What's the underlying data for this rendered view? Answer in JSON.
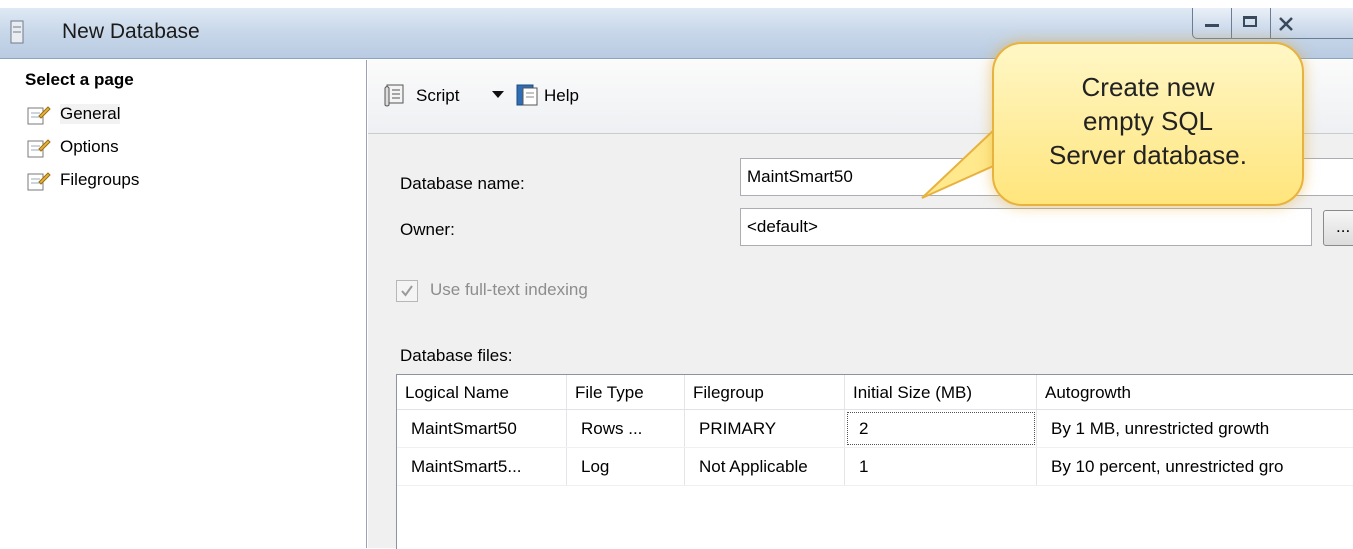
{
  "window": {
    "title": "New Database"
  },
  "left_pane": {
    "heading": "Select a page",
    "pages": [
      {
        "label": "General",
        "selected": true,
        "icon": "page-wrench-icon"
      },
      {
        "label": "Options",
        "selected": false,
        "icon": "page-wrench-icon"
      },
      {
        "label": "Filegroups",
        "selected": false,
        "icon": "page-wrench-icon"
      }
    ]
  },
  "toolbar": {
    "script_label": "Script",
    "help_label": "Help"
  },
  "form": {
    "db_name_label": "Database name:",
    "db_name_value": "MaintSmart50",
    "owner_label": "Owner:",
    "owner_value": "<default>",
    "browse_label": "...",
    "fulltext_label": "Use full-text indexing",
    "fulltext_checked": true,
    "db_files_label": "Database files:"
  },
  "db_files": {
    "columns": [
      "Logical Name",
      "File Type",
      "Filegroup",
      "Initial Size (MB)",
      "Autogrowth"
    ],
    "rows": [
      [
        "MaintSmart50",
        "Rows ...",
        "PRIMARY",
        "2",
        "By 1 MB, unrestricted growth"
      ],
      [
        "MaintSmart5...",
        "Log",
        "Not Applicable",
        "1",
        "By 10 percent, unrestricted gro"
      ]
    ]
  },
  "callout": {
    "lines": [
      "Create new",
      "empty SQL",
      "Server database."
    ]
  },
  "colors": {
    "callout_fill": "#ffe57c",
    "callout_border": "#e8b23f",
    "titlebar": "#c9d8ea",
    "panel_bg": "#f0f0f0"
  }
}
